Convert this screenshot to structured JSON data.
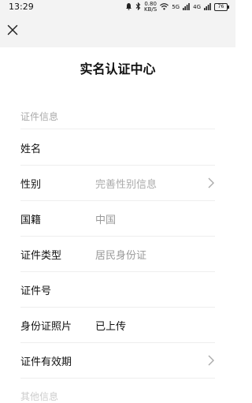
{
  "status_bar": {
    "time": "13:29",
    "speed_top": "0.80",
    "speed_bottom": "KB/S",
    "net1": "5G",
    "net2": "4G",
    "battery": "76"
  },
  "header": {
    "close_icon": "close-icon"
  },
  "page": {
    "title": "实名认证中心"
  },
  "sections": {
    "id_info_label": "证件信息",
    "other_info_label": "其他信息"
  },
  "rows": [
    {
      "label": "姓名",
      "value": ""
    },
    {
      "label": "性别",
      "value": "完善性别信息"
    },
    {
      "label": "国籍",
      "value": "中国"
    },
    {
      "label": "证件类型",
      "value": "居民身份证"
    },
    {
      "label": "证件号",
      "value": ""
    },
    {
      "label": "身份证照片",
      "value": "已上传"
    },
    {
      "label": "证件有效期",
      "value": ""
    }
  ]
}
